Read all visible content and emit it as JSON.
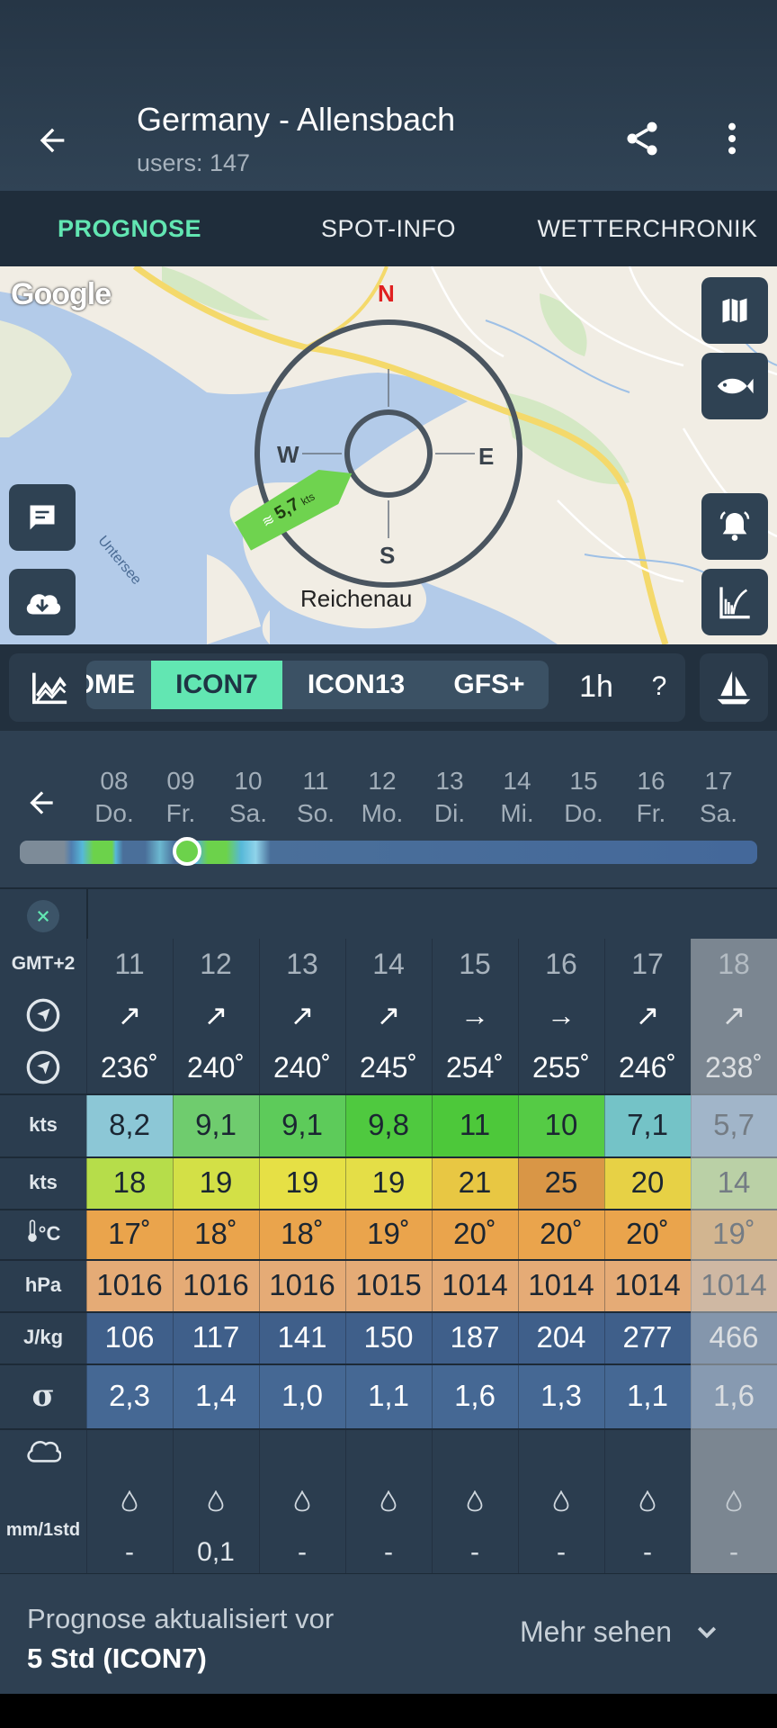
{
  "header": {
    "title": "Germany - Allensbach",
    "subtitle": "users: 147"
  },
  "tabs": [
    {
      "label": "PROGNOSE",
      "active": true
    },
    {
      "label": "SPOT-INFO",
      "active": false
    },
    {
      "label": "WETTERCHRONIK",
      "active": false
    }
  ],
  "map": {
    "google_logo": "Google",
    "town_label": "Reichenau",
    "lake_label": "Untersee",
    "compass": {
      "n": "N",
      "e": "E",
      "s": "S",
      "w": "W"
    },
    "wind_badge": {
      "value": "5,7",
      "unit": "kts"
    },
    "colors": {
      "water": "#b3cbe9",
      "land": "#f1ede4",
      "road": "#f4d96b",
      "accent_green": "#6fd34f",
      "north": "#e02020"
    }
  },
  "models": {
    "items": [
      "OME",
      "ICON7",
      "ICON13",
      "GFS+"
    ],
    "active": "ICON7",
    "interval": "1h",
    "help": "?"
  },
  "days": [
    {
      "num": "08",
      "name": "Do."
    },
    {
      "num": "09",
      "name": "Fr."
    },
    {
      "num": "10",
      "name": "Sa."
    },
    {
      "num": "11",
      "name": "So."
    },
    {
      "num": "12",
      "name": "Mo."
    },
    {
      "num": "13",
      "name": "Di."
    },
    {
      "num": "14",
      "name": "Mi."
    },
    {
      "num": "15",
      "name": "Do."
    },
    {
      "num": "16",
      "name": "Fr."
    },
    {
      "num": "17",
      "name": "Sa."
    }
  ],
  "table": {
    "timezone_label": "GMT+2",
    "hours": [
      "11",
      "12",
      "13",
      "14",
      "15",
      "16",
      "17",
      "18"
    ],
    "direction_arrows": [
      "↗",
      "↗",
      "↗",
      "↗",
      "→",
      "→",
      "↗",
      "↗"
    ],
    "direction_degrees": [
      "236˚",
      "240˚",
      "240˚",
      "245˚",
      "254˚",
      "255˚",
      "246˚",
      "238˚"
    ],
    "wind_label": "kts",
    "wind": [
      "8,2",
      "9,1",
      "9,1",
      "9,8",
      "11",
      "10",
      "7,1",
      "5,7"
    ],
    "gust_label": "kts",
    "gust": [
      "18",
      "19",
      "19",
      "19",
      "21",
      "25",
      "20",
      "14"
    ],
    "temp_label": "°C",
    "temp": [
      "17˚",
      "18˚",
      "18˚",
      "19˚",
      "20˚",
      "20˚",
      "20˚",
      "19˚"
    ],
    "pressure_label": "hPa",
    "pressure": [
      "1016",
      "1016",
      "1016",
      "1015",
      "1014",
      "1014",
      "1014",
      "1014"
    ],
    "cape_label": "J/kg",
    "cape": [
      "106",
      "117",
      "141",
      "150",
      "187",
      "204",
      "277",
      "466"
    ],
    "sigma_label": "σ",
    "sigma": [
      "2,3",
      "1,4",
      "1,0",
      "1,1",
      "1,6",
      "1,3",
      "1,1",
      "1,6"
    ],
    "precip_label": "mm/1std",
    "precip": [
      "-",
      "0,1",
      "-",
      "-",
      "-",
      "-",
      "-",
      "-"
    ]
  },
  "footer": {
    "line1": "Prognose aktualisiert vor",
    "line2": "5 Std (ICON7)",
    "more": "Mehr sehen"
  }
}
